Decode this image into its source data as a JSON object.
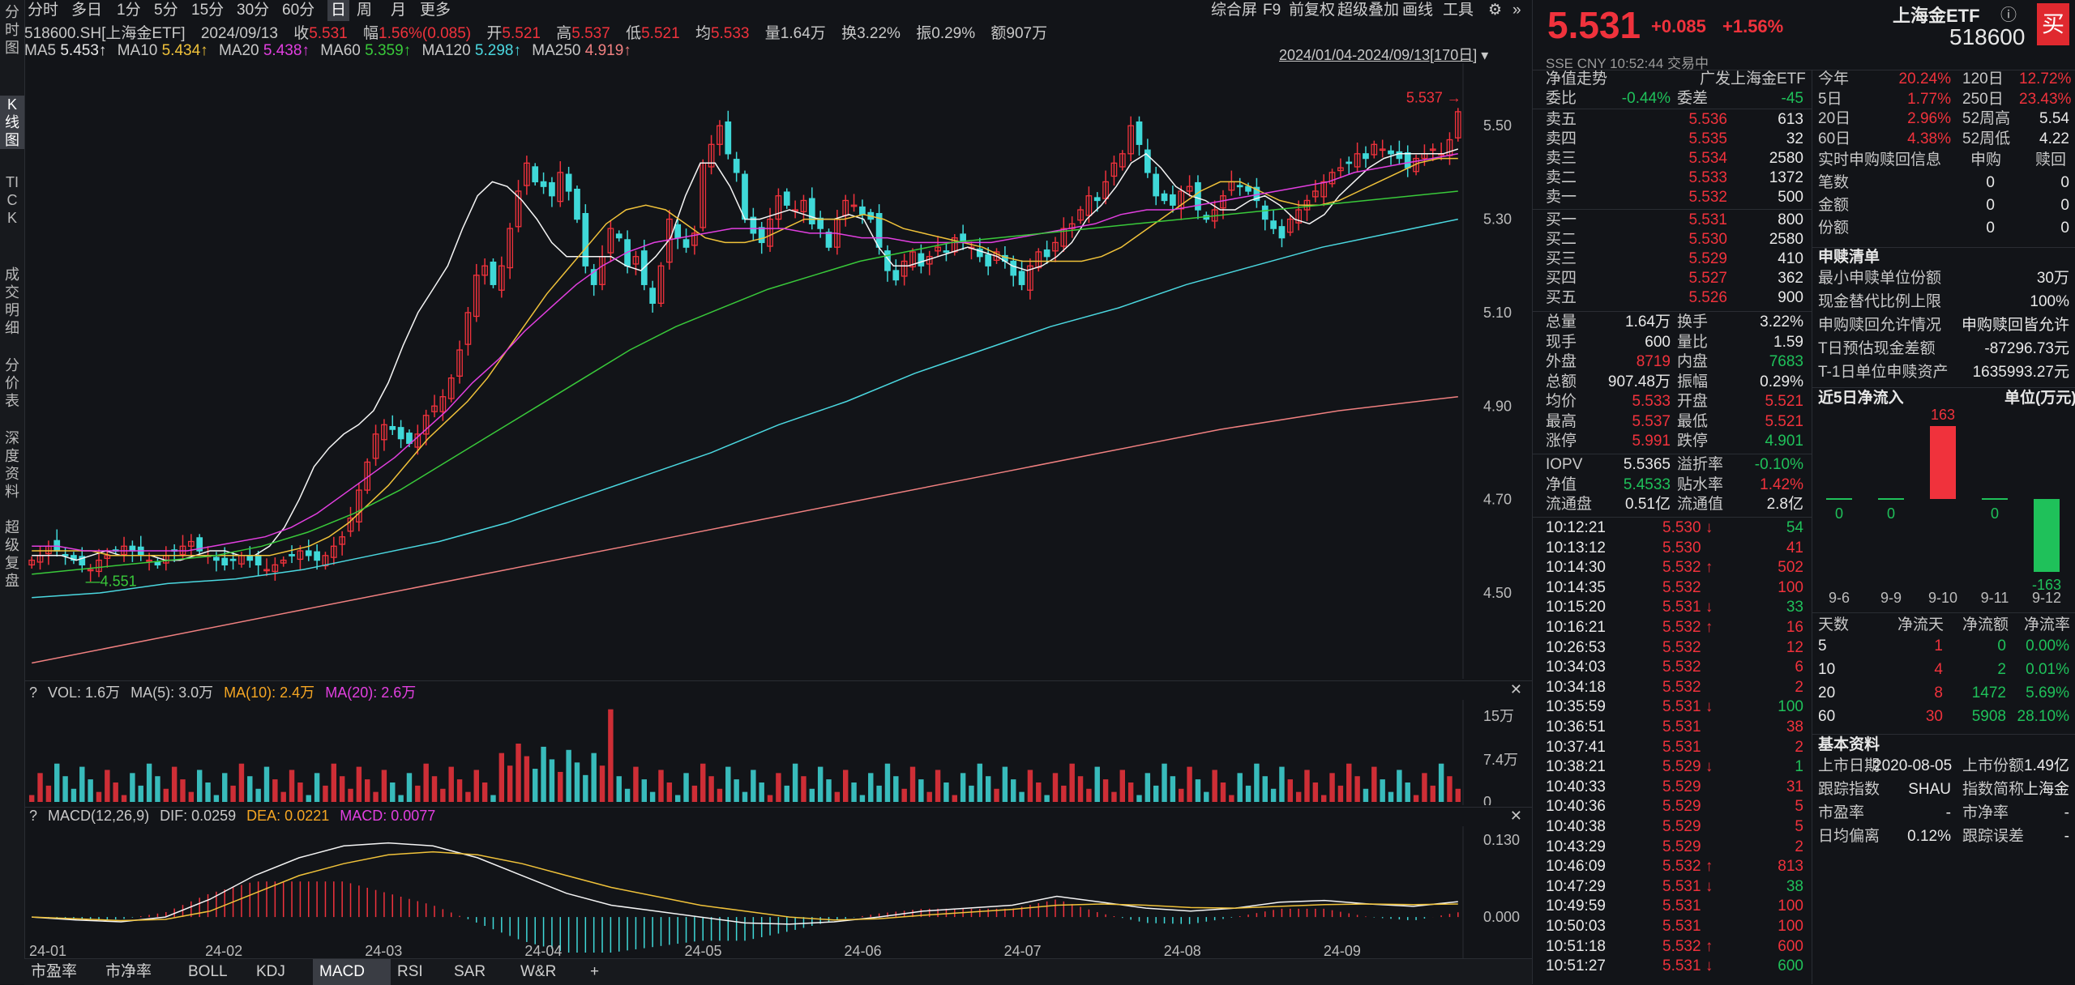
{
  "rail": [
    "分时图",
    "K线图",
    "TICK",
    "成交明细",
    "分价表",
    "深度资料",
    "超级复盘"
  ],
  "top_tabs": [
    "分时",
    "多日",
    "1分",
    "5分",
    "15分",
    "30分",
    "60分",
    "日",
    "周",
    "月",
    "更多"
  ],
  "tools": [
    "综合屏",
    "F9",
    "前复权",
    "超级叠加",
    "画线",
    "工具"
  ],
  "info": {
    "code": "518600.SH[上海金ETF]",
    "date": "2024/09/13",
    "close_l": "收",
    "close": "5.531",
    "chg_l": "幅",
    "chg": "1.56%(0.085)",
    "open_l": "开",
    "open": "5.521",
    "high_l": "高",
    "high": "5.537",
    "low_l": "低",
    "low": "5.521",
    "avg_l": "均",
    "avg": "5.533",
    "vol_l": "量",
    "vol": "1.64万",
    "turn_l": "换",
    "turn": "3.22%",
    "amp_l": "振",
    "amp": "0.29%",
    "amt_l": "额",
    "amt": "907万"
  },
  "ma_row": {
    "ma5": "MA5",
    "ma5v": "5.453↑",
    "ma10": "MA10",
    "ma10v": "5.434↑",
    "ma20": "MA20",
    "ma20v": "5.438↑",
    "ma60": "MA60",
    "ma60v": "5.359↑",
    "ma120": "MA120",
    "ma120v": "5.298↑",
    "ma250": "MA250",
    "ma250v": "4.919↑",
    "range": "2024/01/04-2024/09/13[170日]"
  },
  "vol_head": {
    "q": "?",
    "vol": "VOL: 1.6万",
    "ma5": "MA(5): 3.0万",
    "ma10": "MA(10): 2.4万",
    "ma20": "MA(20): 2.6万"
  },
  "macd_head": {
    "q": "?",
    "title": "MACD(12,26,9)",
    "dif": "DIF: 0.0259",
    "dea": "DEA: 0.0221",
    "macd": "MACD: 0.0077"
  },
  "colors": {
    "up": "#f0323c",
    "down": "#3fd8d8",
    "ma5": "#f5f5f5",
    "ma10": "#f0c23a",
    "ma20": "#e23fe0",
    "ma60": "#39c93a",
    "ma120": "#4bd8e0",
    "ma250": "#f08080"
  },
  "chart_data": [
    {
      "type": "candlestick",
      "title": "518600.SH[上海金ETF] 日K",
      "x_ticks": [
        "24-01",
        "24-02",
        "24-03",
        "24-04",
        "24-05",
        "24-06",
        "24-07",
        "24-08",
        "24-09"
      ],
      "price_ticks": [
        "5.50",
        "5.30",
        "5.10",
        "4.90",
        "4.70",
        "4.50"
      ],
      "ylim": [
        4.33,
        5.62
      ],
      "annotations": {
        "high_mark": "5.537",
        "low_mark": "4.551"
      },
      "close": [
        4.57,
        4.58,
        4.6,
        4.59,
        4.58,
        4.57,
        4.56,
        4.55,
        4.57,
        4.58,
        4.59,
        4.6,
        4.59,
        4.58,
        4.57,
        4.56,
        4.58,
        4.59,
        4.6,
        4.61,
        4.59,
        4.58,
        4.57,
        4.56,
        4.57,
        4.58,
        4.57,
        4.56,
        4.55,
        4.56,
        4.57,
        4.58,
        4.59,
        4.58,
        4.57,
        4.58,
        4.6,
        4.62,
        4.66,
        4.72,
        4.78,
        4.84,
        4.86,
        4.85,
        4.83,
        4.82,
        4.84,
        4.88,
        4.9,
        4.92,
        4.96,
        5.02,
        5.1,
        5.18,
        5.2,
        5.16,
        5.2,
        5.28,
        5.36,
        5.42,
        5.38,
        5.37,
        5.35,
        5.4,
        5.36,
        5.3,
        5.2,
        5.16,
        5.22,
        5.28,
        5.26,
        5.2,
        5.22,
        5.16,
        5.12,
        5.2,
        5.3,
        5.26,
        5.24,
        5.27,
        5.42,
        5.46,
        5.5,
        5.44,
        5.4,
        5.3,
        5.27,
        5.25,
        5.3,
        5.35,
        5.33,
        5.32,
        5.34,
        5.29,
        5.28,
        5.24,
        5.3,
        5.34,
        5.33,
        5.31,
        5.3,
        5.24,
        5.19,
        5.17,
        5.21,
        5.23,
        5.2,
        5.22,
        5.24,
        5.23,
        5.26,
        5.25,
        5.24,
        5.22,
        5.2,
        5.23,
        5.21,
        5.18,
        5.16,
        5.2,
        5.23,
        5.22,
        5.25,
        5.28,
        5.29,
        5.32,
        5.35,
        5.34,
        5.38,
        5.42,
        5.44,
        5.5,
        5.46,
        5.4,
        5.35,
        5.34,
        5.33,
        5.36,
        5.37,
        5.32,
        5.3,
        5.32,
        5.35,
        5.38,
        5.37,
        5.36,
        5.34,
        5.3,
        5.28,
        5.26,
        5.3,
        5.32,
        5.34,
        5.36,
        5.38,
        5.4,
        5.41,
        5.42,
        5.44,
        5.43,
        5.46,
        5.45,
        5.44,
        5.43,
        5.41,
        5.43,
        5.44,
        5.45,
        5.44,
        5.47,
        5.53
      ],
      "ma": {
        "MA5": [
          4.58,
          4.58,
          4.58,
          4.57,
          4.58,
          4.59,
          4.58,
          4.58,
          4.58,
          4.57,
          4.57,
          4.58,
          4.59,
          4.59,
          4.58,
          4.58,
          4.6,
          4.64,
          4.7,
          4.77,
          4.81,
          4.84,
          4.86,
          4.89,
          4.95,
          5.03,
          5.1,
          5.15,
          5.2,
          5.28,
          5.35,
          5.38,
          5.37,
          5.34,
          5.3,
          5.25,
          5.22,
          5.22,
          5.22,
          5.22,
          5.2,
          5.19,
          5.22,
          5.26,
          5.35,
          5.42,
          5.42,
          5.37,
          5.3,
          5.3,
          5.31,
          5.32,
          5.31,
          5.3,
          5.3,
          5.31,
          5.3,
          5.24,
          5.2,
          5.2,
          5.21,
          5.22,
          5.23,
          5.24,
          5.23,
          5.22,
          5.2,
          5.19,
          5.2,
          5.22,
          5.25,
          5.3,
          5.33,
          5.37,
          5.42,
          5.44,
          5.41,
          5.37,
          5.35,
          5.34,
          5.32,
          5.32,
          5.34,
          5.35,
          5.33,
          5.3,
          5.29,
          5.31,
          5.35,
          5.38,
          5.41,
          5.43,
          5.44,
          5.44,
          5.44,
          5.44,
          5.45
        ],
        "MA10": [
          4.59,
          4.59,
          4.59,
          4.59,
          4.58,
          4.58,
          4.58,
          4.58,
          4.58,
          4.58,
          4.58,
          4.58,
          4.58,
          4.59,
          4.6,
          4.62,
          4.65,
          4.69,
          4.73,
          4.78,
          4.83,
          4.87,
          4.91,
          4.96,
          5.02,
          5.08,
          5.14,
          5.19,
          5.24,
          5.29,
          5.32,
          5.33,
          5.32,
          5.29,
          5.26,
          5.25,
          5.25,
          5.26,
          5.28,
          5.3,
          5.3,
          5.3,
          5.31,
          5.3,
          5.28,
          5.27,
          5.26,
          5.25,
          5.24,
          5.22,
          5.21,
          5.21,
          5.21,
          5.21,
          5.22,
          5.24,
          5.27,
          5.3,
          5.33,
          5.36,
          5.38,
          5.38,
          5.36,
          5.34,
          5.33,
          5.33,
          5.34,
          5.36,
          5.38,
          5.4,
          5.42,
          5.43,
          5.43
        ],
        "MA20": [
          4.6,
          4.6,
          4.59,
          4.59,
          4.59,
          4.59,
          4.59,
          4.6,
          4.61,
          4.62,
          4.64,
          4.67,
          4.71,
          4.75,
          4.79,
          4.84,
          4.89,
          4.95,
          5.0,
          5.06,
          5.11,
          5.16,
          5.2,
          5.23,
          5.25,
          5.26,
          5.27,
          5.28,
          5.28,
          5.28,
          5.27,
          5.27,
          5.26,
          5.26,
          5.25,
          5.25,
          5.25,
          5.25,
          5.26,
          5.27,
          5.28,
          5.29,
          5.31,
          5.32,
          5.32,
          5.33,
          5.34,
          5.35,
          5.36,
          5.37,
          5.38,
          5.4,
          5.41,
          5.42,
          5.43,
          5.44
        ],
        "MA60": [
          4.54,
          4.55,
          4.56,
          4.57,
          4.58,
          4.6,
          4.63,
          4.67,
          4.72,
          4.78,
          4.84,
          4.9,
          4.96,
          5.02,
          5.07,
          5.11,
          5.15,
          5.18,
          5.21,
          5.23,
          5.25,
          5.26,
          5.27,
          5.28,
          5.29,
          5.3,
          5.31,
          5.32,
          5.33,
          5.34,
          5.35,
          5.36
        ],
        "MA120": [
          4.49,
          4.5,
          4.52,
          4.53,
          4.55,
          4.58,
          4.61,
          4.65,
          4.7,
          4.75,
          4.8,
          4.86,
          4.91,
          4.97,
          5.02,
          5.07,
          5.11,
          5.16,
          5.2,
          5.24,
          5.27,
          5.3
        ],
        "MA250": [
          4.35,
          4.4,
          4.45,
          4.5,
          4.55,
          4.6,
          4.65,
          4.7,
          4.75,
          4.8,
          4.85,
          4.89,
          4.92
        ]
      }
    },
    {
      "type": "bar",
      "title": "VOL",
      "y_ticks": [
        "15万",
        "7.4万",
        "0"
      ],
      "ylim": [
        0,
        17
      ]
    },
    {
      "type": "bar",
      "title": "MACD(12,26,9)",
      "y_ticks": [
        "0.130",
        "0.000"
      ],
      "ylim": [
        -0.06,
        0.145
      ],
      "dif": [
        0.0,
        -0.005,
        -0.008,
        0.0,
        0.03,
        0.07,
        0.1,
        0.12,
        0.125,
        0.12,
        0.1,
        0.07,
        0.04,
        0.02,
        0.01,
        0.0,
        -0.01,
        -0.012,
        -0.008,
        0.0,
        0.01,
        0.015,
        0.02,
        0.035,
        0.025,
        0.015,
        0.01,
        0.015,
        0.025,
        0.028,
        0.022,
        0.018,
        0.026
      ],
      "dea": [
        0.0,
        -0.003,
        -0.006,
        -0.004,
        0.01,
        0.04,
        0.07,
        0.09,
        0.105,
        0.11,
        0.105,
        0.09,
        0.07,
        0.05,
        0.035,
        0.02,
        0.01,
        0.0,
        -0.005,
        -0.003,
        0.003,
        0.008,
        0.013,
        0.02,
        0.022,
        0.02,
        0.016,
        0.015,
        0.018,
        0.021,
        0.022,
        0.021,
        0.022
      ]
    }
  ],
  "bottom_tabs": [
    "市盈率",
    "市净率",
    "BOLL",
    "KDJ",
    "MACD",
    "RSI",
    "SAR",
    "W&R",
    "+"
  ],
  "rp": {
    "price": "5.531",
    "chg": "+0.085",
    "pct": "+1.56%",
    "name": "上海金ETF",
    "code": "518600",
    "buy_btn": "买",
    "exch": "SSE",
    "ccy": "CNY",
    "time": "10:52:44",
    "status": "交易中",
    "jz_title": "净值走势",
    "fund": "广发上海金ETF",
    "wb_l": "委比",
    "wb": "-0.44%",
    "wc_l": "委差",
    "wc": "-45",
    "asks": [
      [
        "卖五",
        "5.536",
        "613"
      ],
      [
        "卖四",
        "5.535",
        "32"
      ],
      [
        "卖三",
        "5.534",
        "2580"
      ],
      [
        "卖二",
        "5.533",
        "1372"
      ],
      [
        "卖一",
        "5.532",
        "500"
      ]
    ],
    "bids": [
      [
        "买一",
        "5.531",
        "800"
      ],
      [
        "买二",
        "5.530",
        "2580"
      ],
      [
        "买三",
        "5.529",
        "410"
      ],
      [
        "买四",
        "5.527",
        "362"
      ],
      [
        "买五",
        "5.526",
        "900"
      ]
    ],
    "stats": [
      [
        "总量",
        "1.64万",
        "换手",
        "3.22%"
      ],
      [
        "现手",
        "600",
        "量比",
        "1.59"
      ],
      [
        "外盘",
        "8719",
        "内盘",
        "7683"
      ],
      [
        "总额",
        "907.48万",
        "振幅",
        "0.29%"
      ],
      [
        "均价",
        "5.533",
        "开盘",
        "5.521"
      ],
      [
        "最高",
        "5.537",
        "最低",
        "5.521"
      ],
      [
        "涨停",
        "5.991",
        "跌停",
        "4.901"
      ]
    ],
    "iopv": [
      [
        "IOPV",
        "5.5365",
        "溢折率",
        "-0.10%"
      ],
      [
        "净值",
        "5.4533",
        "贴水率",
        "1.42%"
      ],
      [
        "流通盘",
        "0.51亿",
        "流通值",
        "2.8亿"
      ]
    ],
    "ticks": [
      [
        "10:12:21",
        "5.530",
        "54",
        "d"
      ],
      [
        "10:13:12",
        "5.530",
        "41",
        ""
      ],
      [
        "10:14:30",
        "5.532",
        "502",
        "u"
      ],
      [
        "10:14:35",
        "5.532",
        "100",
        ""
      ],
      [
        "10:15:20",
        "5.531",
        "33",
        "d"
      ],
      [
        "10:16:21",
        "5.532",
        "16",
        "u"
      ],
      [
        "10:26:53",
        "5.532",
        "12",
        ""
      ],
      [
        "10:34:03",
        "5.532",
        "6",
        ""
      ],
      [
        "10:34:18",
        "5.532",
        "2",
        ""
      ],
      [
        "10:35:59",
        "5.531",
        "100",
        "d"
      ],
      [
        "10:36:51",
        "5.531",
        "38",
        ""
      ],
      [
        "10:37:41",
        "5.531",
        "2",
        ""
      ],
      [
        "10:38:21",
        "5.529",
        "1",
        "d"
      ],
      [
        "10:40:33",
        "5.529",
        "31",
        ""
      ],
      [
        "10:40:36",
        "5.529",
        "5",
        ""
      ],
      [
        "10:40:38",
        "5.529",
        "5",
        ""
      ],
      [
        "10:43:29",
        "5.529",
        "2",
        ""
      ],
      [
        "10:46:09",
        "5.532",
        "813",
        "u"
      ],
      [
        "10:47:29",
        "5.531",
        "38",
        "d"
      ],
      [
        "10:49:59",
        "5.531",
        "100",
        ""
      ],
      [
        "10:50:03",
        "5.531",
        "100",
        ""
      ],
      [
        "10:51:18",
        "5.532",
        "600",
        "u"
      ],
      [
        "10:51:27",
        "5.531",
        "600",
        "d"
      ]
    ],
    "perf": [
      [
        "今年",
        "20.24%",
        "120日",
        "12.72%"
      ],
      [
        "5日",
        "1.77%",
        "250日",
        "23.43%"
      ],
      [
        "20日",
        "2.96%",
        "52周高",
        "5.54"
      ],
      [
        "60日",
        "4.38%",
        "52周低",
        "4.22"
      ]
    ],
    "sg_head": [
      "实时申购赎回信息",
      "申购",
      "赎回"
    ],
    "sg_rows": [
      [
        "笔数",
        "0",
        "0"
      ],
      [
        "金额",
        "0",
        "0"
      ],
      [
        "份额",
        "0",
        "0"
      ]
    ],
    "qd_title": "申赎清单",
    "qd": [
      [
        "最小申赎单位份额",
        "30万"
      ],
      [
        "现金替代比例上限",
        "100%"
      ],
      [
        "申购赎回允许情况",
        "申购赎回皆允许"
      ],
      [
        "T日预估现金差额",
        "-87296.73元"
      ],
      [
        "T-1日单位申赎资产",
        "1635993.27元"
      ]
    ],
    "flow_title": "近5日净流入",
    "flow_unit": "单位(万元)",
    "flow_chart": {
      "type": "bar",
      "categories": [
        "9-6",
        "9-9",
        "9-10",
        "9-11",
        "9-12"
      ],
      "values": [
        0,
        0,
        163,
        0,
        -163
      ]
    },
    "flow_head": [
      "天数",
      "净流天",
      "净流额",
      "净流率"
    ],
    "flow_rows": [
      [
        "5",
        "1",
        "0",
        "0.00%"
      ],
      [
        "10",
        "4",
        "2",
        "0.01%"
      ],
      [
        "20",
        "8",
        "1472",
        "5.69%"
      ],
      [
        "60",
        "30",
        "5908",
        "28.10%"
      ]
    ],
    "basic_title": "基本资料",
    "basic": [
      [
        "上市日期",
        "2020-08-05",
        "上市份额",
        "1.49亿"
      ],
      [
        "跟踪指数",
        "SHAU",
        "指数简称",
        "上海金"
      ],
      [
        "市盈率",
        "-",
        "市净率",
        "-"
      ],
      [
        "日均偏离",
        "0.12%",
        "跟踪误差",
        "-"
      ]
    ]
  }
}
